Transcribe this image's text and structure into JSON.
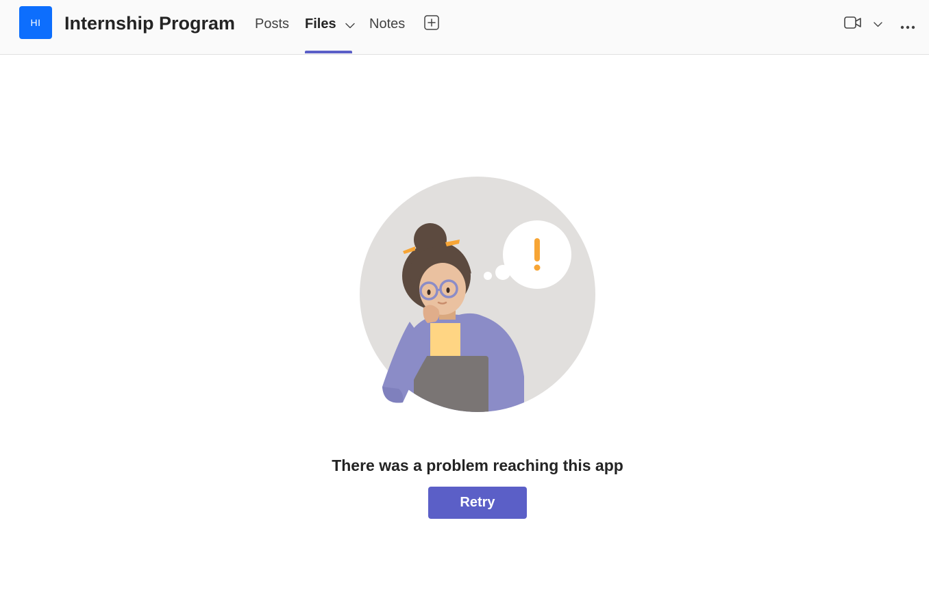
{
  "header": {
    "team_avatar": "HI",
    "team_title": "Internship Program",
    "tabs": [
      {
        "label": "Posts",
        "active": false
      },
      {
        "label": "Files",
        "active": true
      },
      {
        "label": "Notes",
        "active": false
      }
    ],
    "icons": {
      "add_tab": "plus-square-icon",
      "video": "video-camera-icon",
      "video_dropdown": "chevron-down-icon",
      "more": "more-horizontal-icon"
    }
  },
  "error_state": {
    "message": "There was a problem reaching this app",
    "retry_label": "Retry",
    "illustration": "woman-thinking-with-laptop-illustration"
  },
  "colors": {
    "accent": "#5b5fc7",
    "avatar_bg": "#0d6efd",
    "header_bg": "#fafafa"
  }
}
